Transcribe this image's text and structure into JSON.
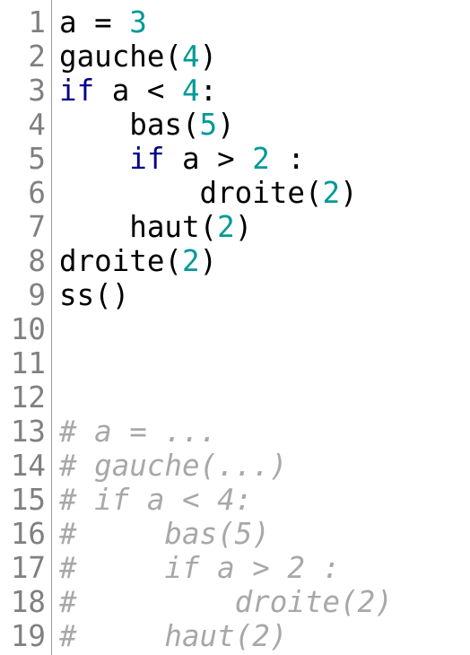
{
  "editor": {
    "line_numbers": [
      "1",
      "2",
      "3",
      "4",
      "5",
      "6",
      "7",
      "8",
      "9",
      "10",
      "11",
      "12",
      "13",
      "14",
      "15",
      "16",
      "17",
      "18",
      "19"
    ],
    "lines": [
      [
        {
          "t": "a = ",
          "k": "plain"
        },
        {
          "t": "3",
          "k": "number"
        }
      ],
      [
        {
          "t": "gauche(",
          "k": "plain"
        },
        {
          "t": "4",
          "k": "number"
        },
        {
          "t": ")",
          "k": "plain"
        }
      ],
      [
        {
          "t": "if",
          "k": "keyword"
        },
        {
          "t": " a < ",
          "k": "plain"
        },
        {
          "t": "4",
          "k": "number"
        },
        {
          "t": ":",
          "k": "plain"
        }
      ],
      [
        {
          "t": "    bas(",
          "k": "plain"
        },
        {
          "t": "5",
          "k": "number"
        },
        {
          "t": ")",
          "k": "plain"
        }
      ],
      [
        {
          "t": "    ",
          "k": "plain"
        },
        {
          "t": "if",
          "k": "keyword"
        },
        {
          "t": " a > ",
          "k": "plain"
        },
        {
          "t": "2",
          "k": "number"
        },
        {
          "t": " :",
          "k": "plain"
        }
      ],
      [
        {
          "t": "        droite(",
          "k": "plain"
        },
        {
          "t": "2",
          "k": "number"
        },
        {
          "t": ")",
          "k": "plain"
        }
      ],
      [
        {
          "t": "    haut(",
          "k": "plain"
        },
        {
          "t": "2",
          "k": "number"
        },
        {
          "t": ")",
          "k": "plain"
        }
      ],
      [
        {
          "t": "droite(",
          "k": "plain"
        },
        {
          "t": "2",
          "k": "number"
        },
        {
          "t": ")",
          "k": "plain"
        }
      ],
      [
        {
          "t": "ss()",
          "k": "plain"
        }
      ],
      [],
      [],
      [],
      [
        {
          "t": "# a = ...",
          "k": "comment"
        }
      ],
      [
        {
          "t": "# gauche(...)",
          "k": "comment"
        }
      ],
      [
        {
          "t": "# if a < 4:",
          "k": "comment"
        }
      ],
      [
        {
          "t": "#     bas(5)",
          "k": "comment"
        }
      ],
      [
        {
          "t": "#     if a > 2 :",
          "k": "comment"
        }
      ],
      [
        {
          "t": "#         droite(2)",
          "k": "comment"
        }
      ],
      [
        {
          "t": "#     haut(2)",
          "k": "comment"
        }
      ]
    ]
  },
  "colors": {
    "number": "#009999",
    "keyword": "#00008b",
    "comment": "#a8a8a8",
    "line_number": "#808080"
  }
}
